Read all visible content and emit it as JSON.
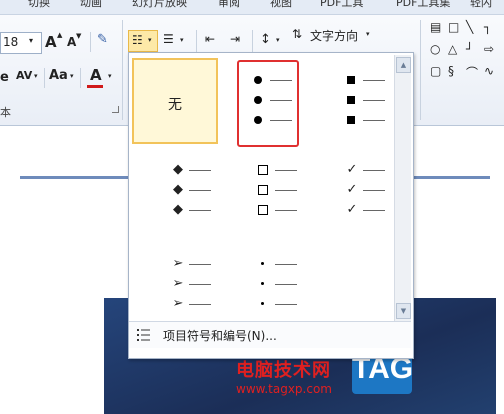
{
  "tabs": [
    "切换",
    "动画",
    "幻灯片放映",
    "审阅",
    "视图",
    "PDF工具",
    "PDF工具集",
    "轻闪"
  ],
  "font": {
    "size_value": "18",
    "grow_label": "A",
    "shrink_label": "A",
    "spacing_label": "AV",
    "case_label": "Aa",
    "color_label": "A",
    "group_label": "本"
  },
  "paragraph": {
    "text_direction_label": "文字方向"
  },
  "bullet_menu": {
    "none_label": "无",
    "bullet_symbols": {
      "arrow": "➢",
      "diamond": "◆",
      "check": "✓"
    },
    "footer_label": "项目符号和编号(N)..."
  },
  "watermark": {
    "site_name": "电脑技术网",
    "url": "www.tagxp.com",
    "tag": "TAG"
  },
  "colors": {
    "accent_blue": "#1d77c4",
    "highlight_red": "#e03030",
    "selected_fill": "#fff8d8",
    "selected_border": "#f2c35a",
    "font_color_red": "#d01a1a"
  }
}
